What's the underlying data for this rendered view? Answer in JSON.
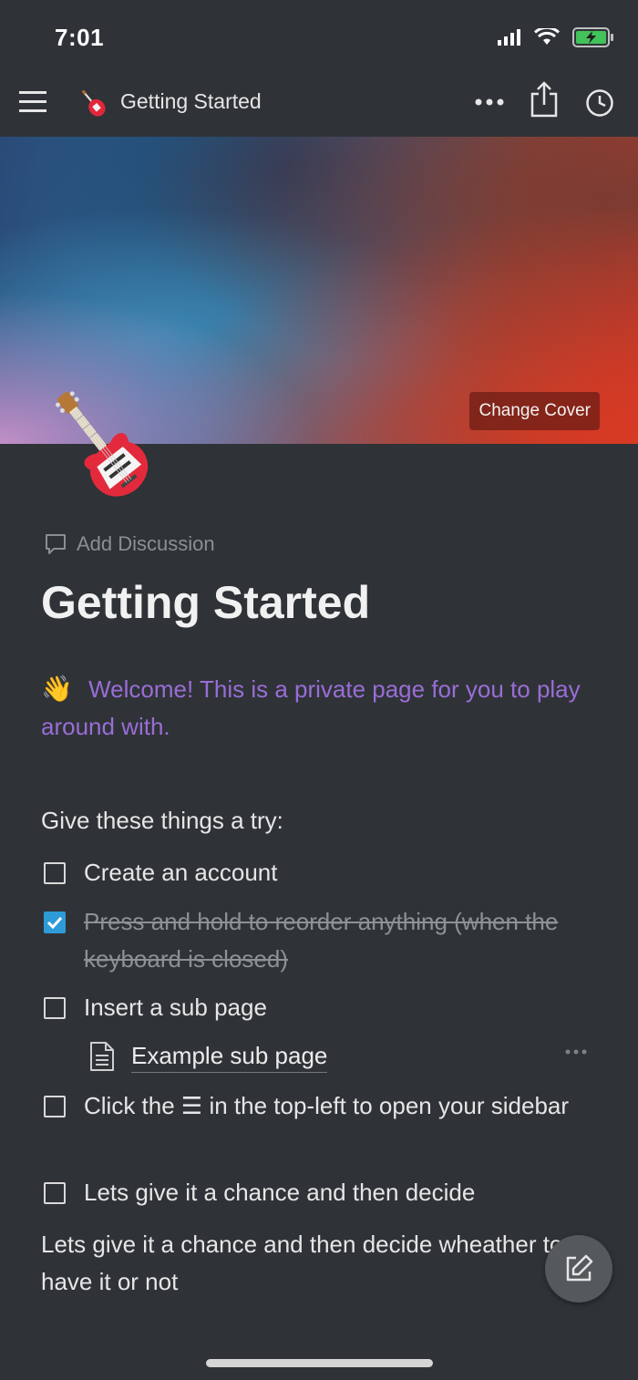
{
  "status": {
    "time": "7:01"
  },
  "topbar": {
    "title": "Getting Started",
    "icon": "guitar-emoji"
  },
  "cover": {
    "change_label": "Change Cover"
  },
  "page": {
    "icon": "guitar-emoji",
    "add_discussion": "Add Discussion",
    "heading": "Getting Started",
    "welcome_emoji": "👋",
    "welcome_text": "Welcome! This is a private page for you to play around with.",
    "intro": "Give these things a try:",
    "todos": [
      {
        "text": "Create an account",
        "checked": false
      },
      {
        "text": "Press and hold to reorder anything (when the keyboard is closed)",
        "checked": true
      },
      {
        "text": "Insert a sub page",
        "checked": false
      },
      {
        "text": "Click the ☰ in the top-left to open your sidebar",
        "checked": false
      },
      {
        "text": "Lets give it a chance and then decide",
        "checked": false
      }
    ],
    "subpage": {
      "title": "Example sub page"
    },
    "paragraph": "Lets give it a chance and then decide wheather to have it or not"
  },
  "colors": {
    "background": "#2f3337",
    "accent": "#9a6dd7",
    "checkbox": "#2e9bd9"
  }
}
